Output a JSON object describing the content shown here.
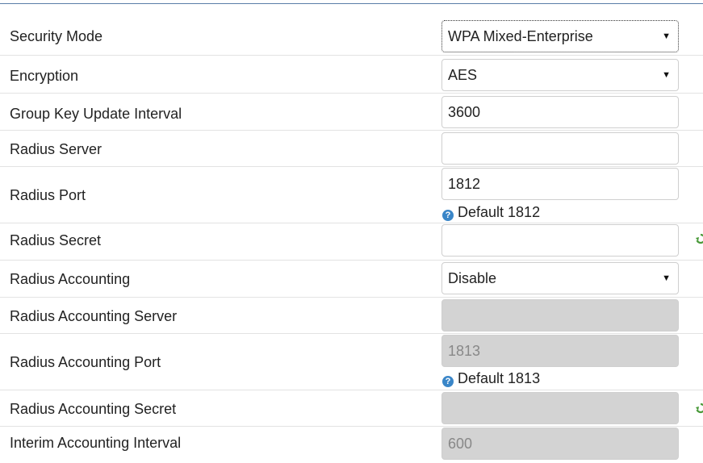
{
  "form": {
    "security_mode": {
      "label": "Security Mode",
      "value": "WPA Mixed-Enterprise"
    },
    "encryption": {
      "label": "Encryption",
      "value": "AES"
    },
    "group_key_update_interval": {
      "label": "Group Key Update Interval",
      "value": "3600"
    },
    "radius_server": {
      "label": "Radius Server",
      "value": ""
    },
    "radius_port": {
      "label": "Radius Port",
      "value": "1812",
      "hint": "Default 1812"
    },
    "radius_secret": {
      "label": "Radius Secret",
      "value": ""
    },
    "radius_accounting": {
      "label": "Radius Accounting",
      "value": "Disable"
    },
    "radius_accounting_server": {
      "label": "Radius Accounting Server",
      "value": ""
    },
    "radius_accounting_port": {
      "label": "Radius Accounting Port",
      "value": "1813",
      "hint": "Default 1813"
    },
    "radius_accounting_secret": {
      "label": "Radius Accounting Secret",
      "value": ""
    },
    "interim_accounting_interval": {
      "label": "Interim Accounting Interval",
      "value": "600"
    }
  },
  "icons": {
    "help": "question-circle-icon",
    "generate": "refresh-key-icon"
  },
  "colors": {
    "help_icon": "#3a86c8",
    "generate_icon": "#4a9a3a",
    "disabled_field": "#d3d3d3",
    "top_border": "#5a7ea8"
  }
}
